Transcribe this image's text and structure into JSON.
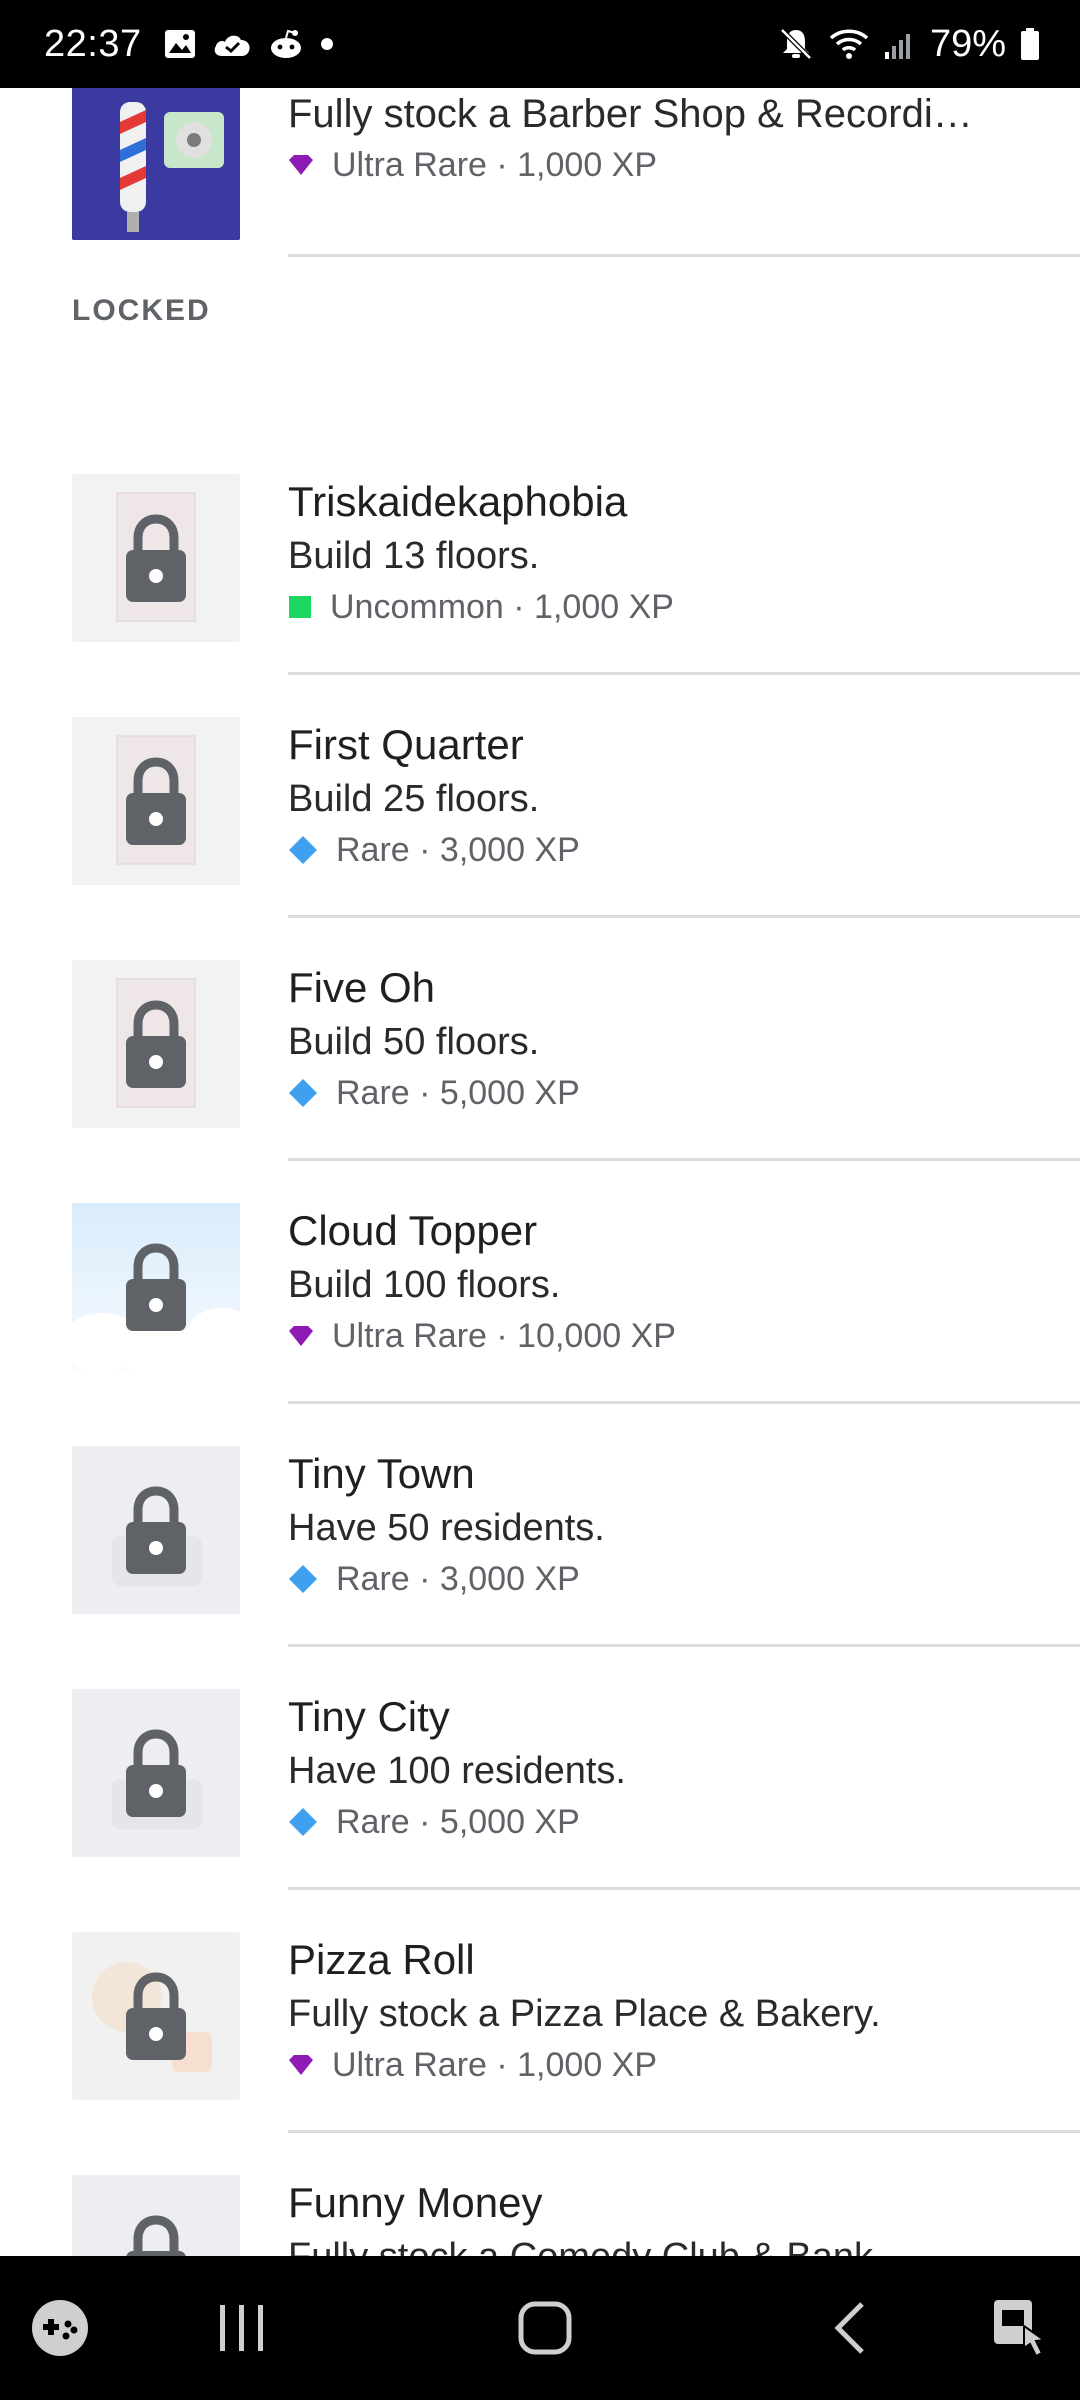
{
  "status_bar": {
    "time": "22:37",
    "battery": "79%",
    "left_icons": [
      "gallery-icon",
      "cloud-icon",
      "reddit-icon",
      "dot-icon"
    ],
    "right_icons": [
      "mute-icon",
      "wifi-icon",
      "signal-icon",
      "battery-icon"
    ]
  },
  "partial_item": {
    "description": "Fully stock a Barber Shop & Recordi…",
    "rarity": "Ultra Rare",
    "xp": "1,000 XP",
    "meta": "Ultra Rare · 1,000 XP",
    "rarity_color": "#8e1bb3"
  },
  "section": {
    "label": "LOCKED"
  },
  "items": [
    {
      "title": "Triskaidekaphobia",
      "description": "Build 13 floors.",
      "rarity": "Uncommon",
      "xp": "1,000 XP",
      "meta": "Uncommon · 1,000 XP",
      "rarity_icon": "square",
      "rarity_color": "#1ed760",
      "thumb": "gray"
    },
    {
      "title": "First Quarter",
      "description": "Build 25 floors.",
      "rarity": "Rare",
      "xp": "3,000 XP",
      "meta": "Rare · 3,000 XP",
      "rarity_icon": "diamond",
      "rarity_color": "#3fa0f0",
      "thumb": "gray"
    },
    {
      "title": "Five Oh",
      "description": "Build 50 floors.",
      "rarity": "Rare",
      "xp": "5,000 XP",
      "meta": "Rare · 5,000 XP",
      "rarity_icon": "diamond",
      "rarity_color": "#3fa0f0",
      "thumb": "gray"
    },
    {
      "title": "Cloud Topper",
      "description": "Build 100 floors.",
      "rarity": "Ultra Rare",
      "xp": "10,000 XP",
      "meta": "Ultra Rare · 10,000 XP",
      "rarity_icon": "gem",
      "rarity_color": "#8e1bb3",
      "thumb": "sky"
    },
    {
      "title": "Tiny Town",
      "description": "Have 50 residents.",
      "rarity": "Rare",
      "xp": "3,000 XP",
      "meta": "Rare · 3,000 XP",
      "rarity_icon": "diamond",
      "rarity_color": "#3fa0f0",
      "thumb": "town"
    },
    {
      "title": "Tiny City",
      "description": "Have 100 residents.",
      "rarity": "Rare",
      "xp": "5,000 XP",
      "meta": "Rare · 5,000 XP",
      "rarity_icon": "diamond",
      "rarity_color": "#3fa0f0",
      "thumb": "town"
    },
    {
      "title": "Pizza Roll",
      "description": "Fully stock a Pizza Place & Bakery.",
      "rarity": "Ultra Rare",
      "xp": "1,000 XP",
      "meta": "Ultra Rare · 1,000 XP",
      "rarity_icon": "gem",
      "rarity_color": "#8e1bb3",
      "thumb": "pizza"
    },
    {
      "title": "Funny Money",
      "description": "Fully stock a Comedy Club & Bank.",
      "rarity": "",
      "xp": "",
      "meta": "",
      "rarity_icon": "none",
      "rarity_color": "#8e1bb3",
      "thumb": "town"
    }
  ],
  "nav_bar": {
    "buttons": [
      "game-launcher-icon",
      "recent-apps-icon",
      "home-icon",
      "back-icon",
      "accessibility-icon"
    ]
  }
}
